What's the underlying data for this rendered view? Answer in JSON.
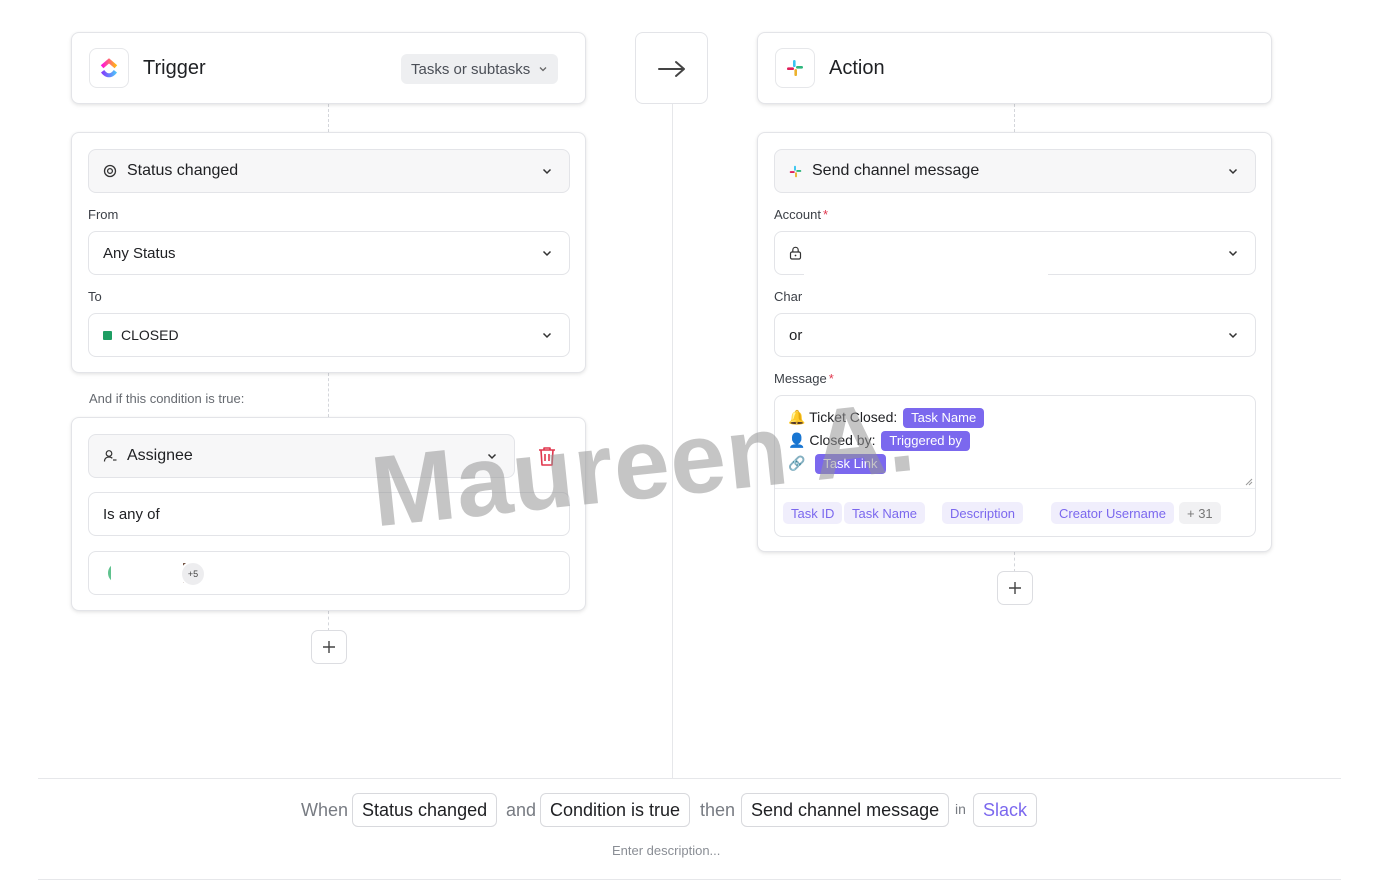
{
  "trigger": {
    "title": "Trigger",
    "scope_select": "Tasks or subtasks",
    "event_select": "Status changed",
    "from_label": "From",
    "from_value": "Any Status",
    "to_label": "To",
    "to_value": "CLOSED",
    "to_status_color": "#1e9e63"
  },
  "condition": {
    "caption": "And if this condition is true:",
    "field_select": "Assignee",
    "operator_select": "Is any of",
    "more_count": "+5"
  },
  "action": {
    "title": "Action",
    "action_select": "Send channel message",
    "account_label": "Account",
    "channel_label": "Char",
    "channel_value": "or",
    "message_label": "Message",
    "message_lines": [
      {
        "emoji": "🔔",
        "text": "Ticket Closed:",
        "tag": "Task Name"
      },
      {
        "emoji": "👤",
        "text": "Closed by:",
        "tag": "Triggered by"
      },
      {
        "emoji": "🔗",
        "text": "",
        "tag": "Task Link"
      }
    ],
    "variables": [
      "Task ID",
      "Task Name",
      "Description",
      "Creator Username"
    ],
    "variables_more": "+ 31"
  },
  "summary": {
    "when": "When",
    "trigger": "Status changed",
    "and": "and",
    "condition": "Condition is true",
    "then": "then",
    "action": "Send channel message",
    "in": "in",
    "app": "Slack",
    "app_color": "#7b68ee",
    "description_placeholder": "Enter description..."
  },
  "watermark": "Maureen A.",
  "icons": [
    "clickup-logo-icon",
    "slack-logo-icon",
    "arrow-right-icon",
    "status-icon",
    "chevron-down-icon",
    "assignee-icon",
    "trash-icon",
    "lock-icon",
    "plus-icon",
    "resize-handle-icon"
  ],
  "colors": {
    "accent": "#7b68ee",
    "danger": "#e0364d"
  }
}
